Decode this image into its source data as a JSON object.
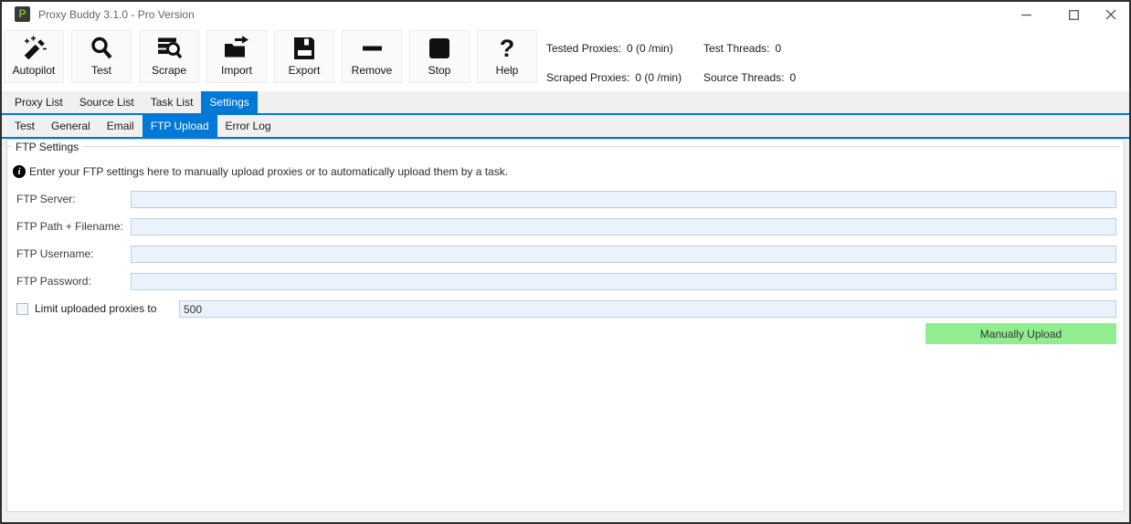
{
  "window": {
    "title": "Proxy Buddy 3.1.0 - Pro Version",
    "icon_text": "P"
  },
  "toolbar": {
    "buttons": [
      {
        "label": "Autopilot",
        "icon": "magic-wand-icon"
      },
      {
        "label": "Test",
        "icon": "magnifier-icon"
      },
      {
        "label": "Scrape",
        "icon": "list-search-icon"
      },
      {
        "label": "Import",
        "icon": "folder-import-icon"
      },
      {
        "label": "Export",
        "icon": "floppy-disk-icon"
      },
      {
        "label": "Remove",
        "icon": "minus-icon"
      },
      {
        "label": "Stop",
        "icon": "stop-square-icon"
      },
      {
        "label": "Help",
        "icon": "question-mark-icon",
        "glyph": "?"
      }
    ]
  },
  "stats": [
    {
      "label": "Tested Proxies:",
      "value": "0 (0 /min)"
    },
    {
      "label": "Test Threads:",
      "value": "0"
    },
    {
      "label": "Scraped Proxies:",
      "value": "0 (0 /min)"
    },
    {
      "label": "Source Threads:",
      "value": "0"
    }
  ],
  "tabs": {
    "main": [
      {
        "label": "Proxy List",
        "selected": false
      },
      {
        "label": "Source List",
        "selected": false
      },
      {
        "label": "Task List",
        "selected": false
      },
      {
        "label": "Settings",
        "selected": true
      }
    ],
    "settings": [
      {
        "label": "Test",
        "selected": false
      },
      {
        "label": "General",
        "selected": false
      },
      {
        "label": "Email",
        "selected": false
      },
      {
        "label": "FTP Upload",
        "selected": true
      },
      {
        "label": "Error Log",
        "selected": false
      }
    ]
  },
  "ftp": {
    "group_title": "FTP Settings",
    "info_text": "Enter your FTP settings here to manually upload proxies or to automatically upload them by a task.",
    "fields": [
      {
        "label": "FTP Server:",
        "value": ""
      },
      {
        "label": "FTP Path + Filename:",
        "value": ""
      },
      {
        "label": "FTP Username:",
        "value": ""
      },
      {
        "label": "FTP Password:",
        "value": ""
      }
    ],
    "limit": {
      "label": "Limit uploaded proxies to",
      "checked": false,
      "value": "500"
    },
    "upload_button": "Manually Upload"
  },
  "colors": {
    "accent_blue": "#0078d7",
    "upload_green": "#90ee90",
    "input_bg": "#eaf2fb",
    "input_border": "#bad1e4",
    "app_icon_green": "#76bf2f"
  }
}
